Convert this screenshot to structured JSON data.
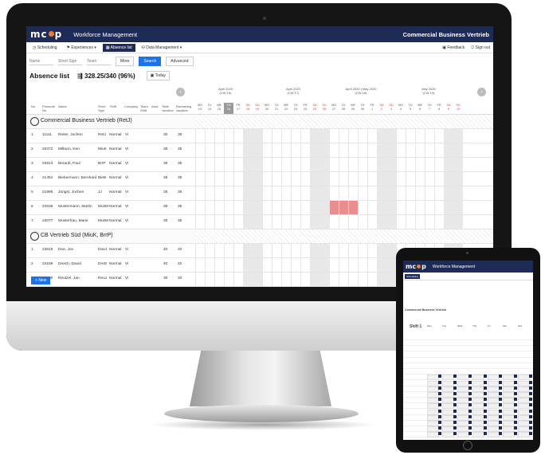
{
  "app": {
    "logo": "mc",
    "logo_end": "p",
    "title": "Workforce Management",
    "company": "Commercial Business Vertrieb"
  },
  "nav": {
    "items": [
      "Scheduling",
      "Experiences ▾",
      "Absence list",
      "Data Management ▾"
    ],
    "active": "Absence list",
    "feedback": "Feedback",
    "signout": "Sign out"
  },
  "filters": {
    "name_placeholder": "Name",
    "short_sign_placeholder": "Short Sign",
    "team_placeholder": "Team",
    "more": "More",
    "search": "Search",
    "advanced": "Advanced"
  },
  "absence": {
    "title": "Absence list",
    "count": "328.25/340 (96%)",
    "today": "Today"
  },
  "months": [
    {
      "label": "April 2020",
      "week": "(CW 16)"
    },
    {
      "label": "April 2020",
      "week": "(CW 17)"
    },
    {
      "label": "April 2020 | May 2020",
      "week": "(CW 18)"
    },
    {
      "label": "May 2020",
      "week": "(CW 19)"
    }
  ],
  "columns": {
    "no": "No.",
    "personal": "Personal No.",
    "name": "Name",
    "short": "Short Sign",
    "shift": "Shift",
    "company": "Company",
    "team": "Team Shift",
    "area": "Area",
    "total": "Total vacation",
    "remaining": "Remaining vacation"
  },
  "days": [
    [
      "MO",
      "13"
    ],
    [
      "TU",
      "14"
    ],
    [
      "WE",
      "15"
    ],
    [
      "TH",
      "16"
    ],
    [
      "FR",
      "17"
    ],
    [
      "SA",
      "18"
    ],
    [
      "SU",
      "19"
    ],
    [
      "MO",
      "20"
    ],
    [
      "TU",
      "21"
    ],
    [
      "WE",
      "22"
    ],
    [
      "TH",
      "23"
    ],
    [
      "FR",
      "24"
    ],
    [
      "SA",
      "25"
    ],
    [
      "SU",
      "26"
    ],
    [
      "MO",
      "27"
    ],
    [
      "TU",
      "28"
    ],
    [
      "WE",
      "29"
    ],
    [
      "TH",
      "30"
    ],
    [
      "FR",
      "1"
    ],
    [
      "SA",
      "2"
    ],
    [
      "SU",
      "3"
    ],
    [
      "MO",
      "4"
    ],
    [
      "TU",
      "5"
    ],
    [
      "WE",
      "6"
    ],
    [
      "TH",
      "7"
    ],
    [
      "FR",
      "8"
    ],
    [
      "SA",
      "9"
    ],
    [
      "SU",
      "10"
    ]
  ],
  "groups": [
    {
      "name": "Commercial Business Vertrieb (RetJ)",
      "rows": [
        {
          "no": "1",
          "pn": "11111",
          "name": "Reiter, Jochen",
          "short": "RetJ",
          "shift": "Normal",
          "company": "Vi",
          "total": "30",
          "remaining": "35"
        },
        {
          "no": "2",
          "pn": "20372",
          "name": "Milburn, Ken",
          "short": "MiuK",
          "shift": "Normal",
          "company": "Vi",
          "total": "35",
          "remaining": "35"
        },
        {
          "no": "3",
          "pn": "20913",
          "name": "Berardi, Paul",
          "short": "BrrP",
          "shift": "Normal",
          "company": "Vi",
          "total": "35",
          "remaining": "35"
        },
        {
          "no": "4",
          "pn": "21454",
          "name": "Biebermann, Bernhard",
          "short": "BieB",
          "shift": "Normal",
          "company": "Vi",
          "total": "35",
          "remaining": "35"
        },
        {
          "no": "5",
          "pn": "21995",
          "name": "Jüngst, Jochen",
          "short": "JJ",
          "shift": "Normal",
          "company": "Vi",
          "total": "35",
          "remaining": "35"
        },
        {
          "no": "6",
          "pn": "22536",
          "name": "Mustermann, Martin",
          "short": "MusM",
          "shift": "Normal",
          "company": "Vi",
          "total": "35",
          "remaining": "35"
        },
        {
          "no": "7",
          "pn": "23077",
          "name": "Musterfrau, Marie",
          "short": "MusM",
          "shift": "Normal",
          "company": "Vi",
          "total": "35",
          "remaining": "35"
        }
      ]
    },
    {
      "name": "CB Vertrieb Süd (MiuK, BrrP)",
      "rows": [
        {
          "no": "1",
          "pn": "23618",
          "name": "Doe, Jon",
          "short": "DoeJ",
          "shift": "Normal",
          "company": "Vi",
          "total": "40",
          "remaining": "40"
        },
        {
          "no": "2",
          "pn": "24159",
          "name": "Dreich, David",
          "short": "DreD",
          "shift": "Normal",
          "company": "Vi",
          "total": "40",
          "remaining": "40"
        },
        {
          "no": "3",
          "pn": "24700",
          "name": "Reutzel, Jan",
          "short": "ReuJ",
          "shift": "Normal",
          "company": "Vi",
          "total": "30",
          "remaining": "30"
        }
      ]
    }
  ],
  "new_button": "New",
  "tablet": {
    "title": "Workforce Management",
    "section": "Commercial Business Vertrieb",
    "shift": "Shift 1",
    "days": [
      "Mon",
      "Tue",
      "Wed",
      "Thu",
      "Fri",
      "Sat",
      "Sun"
    ]
  },
  "colors": {
    "primary": "#1f2b57",
    "accent": "#1a73e8",
    "logo_dot": "#f07b2e",
    "absence": "#e88e8e"
  }
}
